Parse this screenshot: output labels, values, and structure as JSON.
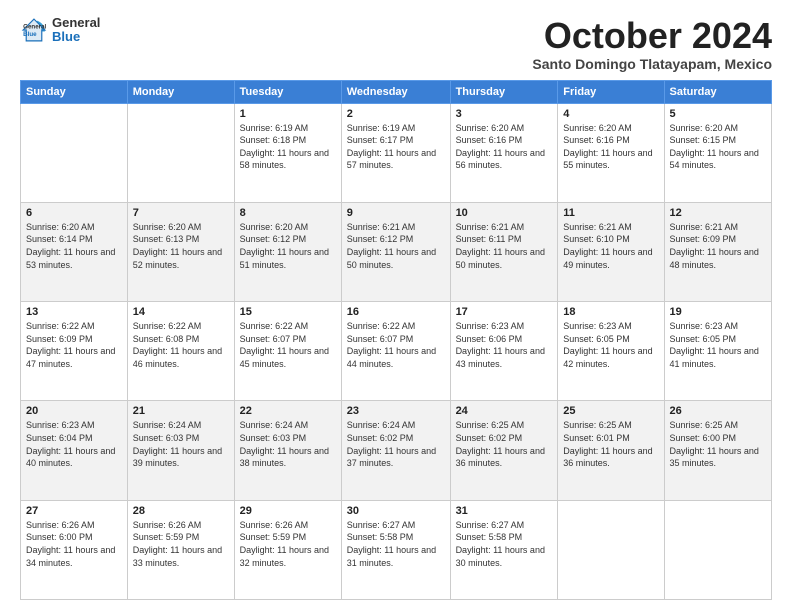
{
  "logo": {
    "general": "General",
    "blue": "Blue"
  },
  "header": {
    "month": "October 2024",
    "location": "Santo Domingo Tlatayapam, Mexico"
  },
  "weekdays": [
    "Sunday",
    "Monday",
    "Tuesday",
    "Wednesday",
    "Thursday",
    "Friday",
    "Saturday"
  ],
  "weeks": [
    [
      {
        "day": "",
        "info": ""
      },
      {
        "day": "",
        "info": ""
      },
      {
        "day": "1",
        "info": "Sunrise: 6:19 AM\nSunset: 6:18 PM\nDaylight: 11 hours and 58 minutes."
      },
      {
        "day": "2",
        "info": "Sunrise: 6:19 AM\nSunset: 6:17 PM\nDaylight: 11 hours and 57 minutes."
      },
      {
        "day": "3",
        "info": "Sunrise: 6:20 AM\nSunset: 6:16 PM\nDaylight: 11 hours and 56 minutes."
      },
      {
        "day": "4",
        "info": "Sunrise: 6:20 AM\nSunset: 6:16 PM\nDaylight: 11 hours and 55 minutes."
      },
      {
        "day": "5",
        "info": "Sunrise: 6:20 AM\nSunset: 6:15 PM\nDaylight: 11 hours and 54 minutes."
      }
    ],
    [
      {
        "day": "6",
        "info": "Sunrise: 6:20 AM\nSunset: 6:14 PM\nDaylight: 11 hours and 53 minutes."
      },
      {
        "day": "7",
        "info": "Sunrise: 6:20 AM\nSunset: 6:13 PM\nDaylight: 11 hours and 52 minutes."
      },
      {
        "day": "8",
        "info": "Sunrise: 6:20 AM\nSunset: 6:12 PM\nDaylight: 11 hours and 51 minutes."
      },
      {
        "day": "9",
        "info": "Sunrise: 6:21 AM\nSunset: 6:12 PM\nDaylight: 11 hours and 50 minutes."
      },
      {
        "day": "10",
        "info": "Sunrise: 6:21 AM\nSunset: 6:11 PM\nDaylight: 11 hours and 50 minutes."
      },
      {
        "day": "11",
        "info": "Sunrise: 6:21 AM\nSunset: 6:10 PM\nDaylight: 11 hours and 49 minutes."
      },
      {
        "day": "12",
        "info": "Sunrise: 6:21 AM\nSunset: 6:09 PM\nDaylight: 11 hours and 48 minutes."
      }
    ],
    [
      {
        "day": "13",
        "info": "Sunrise: 6:22 AM\nSunset: 6:09 PM\nDaylight: 11 hours and 47 minutes."
      },
      {
        "day": "14",
        "info": "Sunrise: 6:22 AM\nSunset: 6:08 PM\nDaylight: 11 hours and 46 minutes."
      },
      {
        "day": "15",
        "info": "Sunrise: 6:22 AM\nSunset: 6:07 PM\nDaylight: 11 hours and 45 minutes."
      },
      {
        "day": "16",
        "info": "Sunrise: 6:22 AM\nSunset: 6:07 PM\nDaylight: 11 hours and 44 minutes."
      },
      {
        "day": "17",
        "info": "Sunrise: 6:23 AM\nSunset: 6:06 PM\nDaylight: 11 hours and 43 minutes."
      },
      {
        "day": "18",
        "info": "Sunrise: 6:23 AM\nSunset: 6:05 PM\nDaylight: 11 hours and 42 minutes."
      },
      {
        "day": "19",
        "info": "Sunrise: 6:23 AM\nSunset: 6:05 PM\nDaylight: 11 hours and 41 minutes."
      }
    ],
    [
      {
        "day": "20",
        "info": "Sunrise: 6:23 AM\nSunset: 6:04 PM\nDaylight: 11 hours and 40 minutes."
      },
      {
        "day": "21",
        "info": "Sunrise: 6:24 AM\nSunset: 6:03 PM\nDaylight: 11 hours and 39 minutes."
      },
      {
        "day": "22",
        "info": "Sunrise: 6:24 AM\nSunset: 6:03 PM\nDaylight: 11 hours and 38 minutes."
      },
      {
        "day": "23",
        "info": "Sunrise: 6:24 AM\nSunset: 6:02 PM\nDaylight: 11 hours and 37 minutes."
      },
      {
        "day": "24",
        "info": "Sunrise: 6:25 AM\nSunset: 6:02 PM\nDaylight: 11 hours and 36 minutes."
      },
      {
        "day": "25",
        "info": "Sunrise: 6:25 AM\nSunset: 6:01 PM\nDaylight: 11 hours and 36 minutes."
      },
      {
        "day": "26",
        "info": "Sunrise: 6:25 AM\nSunset: 6:00 PM\nDaylight: 11 hours and 35 minutes."
      }
    ],
    [
      {
        "day": "27",
        "info": "Sunrise: 6:26 AM\nSunset: 6:00 PM\nDaylight: 11 hours and 34 minutes."
      },
      {
        "day": "28",
        "info": "Sunrise: 6:26 AM\nSunset: 5:59 PM\nDaylight: 11 hours and 33 minutes."
      },
      {
        "day": "29",
        "info": "Sunrise: 6:26 AM\nSunset: 5:59 PM\nDaylight: 11 hours and 32 minutes."
      },
      {
        "day": "30",
        "info": "Sunrise: 6:27 AM\nSunset: 5:58 PM\nDaylight: 11 hours and 31 minutes."
      },
      {
        "day": "31",
        "info": "Sunrise: 6:27 AM\nSunset: 5:58 PM\nDaylight: 11 hours and 30 minutes."
      },
      {
        "day": "",
        "info": ""
      },
      {
        "day": "",
        "info": ""
      }
    ]
  ]
}
